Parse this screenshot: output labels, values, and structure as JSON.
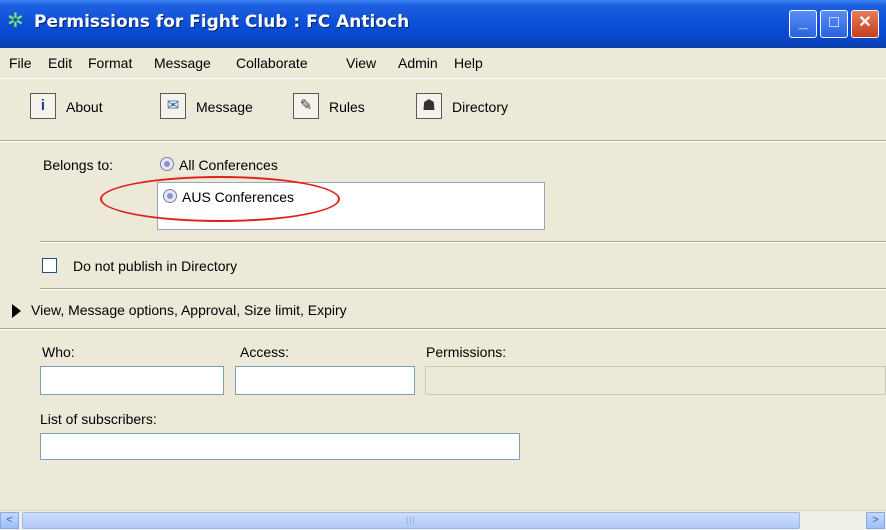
{
  "window": {
    "title": "Permissions for Fight Club : FC Antioch",
    "minimize_glyph": "_",
    "maximize_glyph": "□",
    "close_glyph": "✕"
  },
  "menu": {
    "items": [
      "File",
      "Edit",
      "Format",
      "Message",
      "Collaborate",
      "View",
      "Admin",
      "Help"
    ]
  },
  "toolbar": {
    "about": {
      "label": "About",
      "icon": "info-icon"
    },
    "message": {
      "label": "Message",
      "icon": "message-icon"
    },
    "rules": {
      "label": "Rules",
      "icon": "rules-icon"
    },
    "directory": {
      "label": "Directory",
      "icon": "directory-icon"
    }
  },
  "belongs": {
    "label": "Belongs to:",
    "primary": "All Conferences",
    "list": [
      "AUS Conferences"
    ],
    "annotation_color": "#e0201a"
  },
  "publish": {
    "label": "Do not publish in Directory",
    "checked": false
  },
  "options": {
    "label": "View, Message options, Approval, Size limit, Expiry"
  },
  "access": {
    "who_label": "Who:",
    "access_label": "Access:",
    "permissions_label": "Permissions:",
    "who_value": "",
    "access_value": "",
    "permissions_value": ""
  },
  "subscribers": {
    "label": "List of subscribers:",
    "value": ""
  },
  "scrollbar": {
    "left_glyph": "<",
    "right_glyph": ">",
    "grip": "|||"
  },
  "colors": {
    "titlebar": "#0A4FD8",
    "window_bg": "#ECE9D8",
    "annotation": "#e0201a"
  }
}
